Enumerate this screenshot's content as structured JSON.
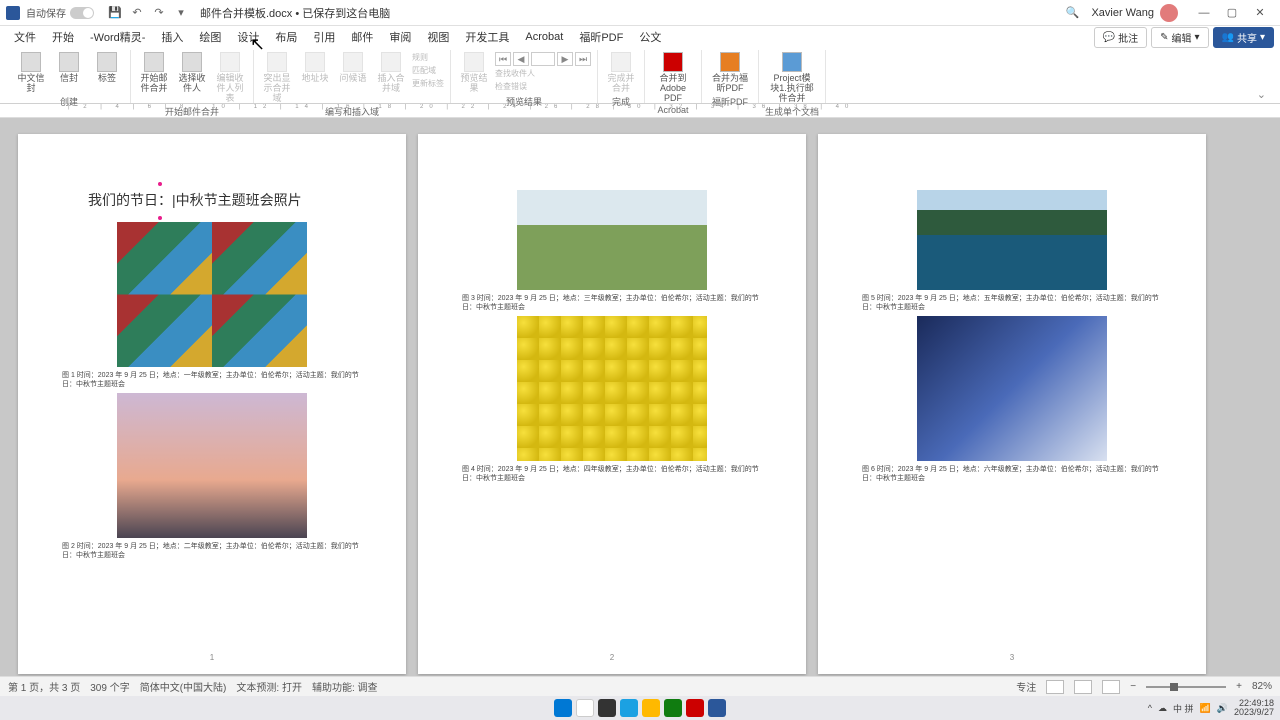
{
  "titlebar": {
    "autosave": "自动保存",
    "docname": "邮件合并模板.docx • 已保存到这台电脑",
    "user": "Xavier Wang"
  },
  "menu": {
    "tabs": [
      "文件",
      "开始",
      "-Word精灵-",
      "插入",
      "绘图",
      "设计",
      "布局",
      "引用",
      "邮件",
      "审阅",
      "视图",
      "开发工具",
      "Acrobat",
      "福昕PDF",
      "公文"
    ],
    "comment": "批注",
    "edit": "编辑",
    "share": "共享"
  },
  "ribbon": {
    "g1": {
      "label": "创建",
      "btns": [
        "中文信封",
        "信封",
        "标签"
      ]
    },
    "g2": {
      "label": "开始邮件合并",
      "btns": [
        "开始邮件合并",
        "选择收件人",
        "编辑收件人列表"
      ]
    },
    "g3": {
      "label": "编写和插入域",
      "btns": [
        "突出显示合并域",
        "地址块",
        "问候语",
        "插入合并域"
      ],
      "side": [
        "规则",
        "匹配域",
        "更新标签"
      ]
    },
    "g4": {
      "label": "预览结果",
      "btns": [
        "预览结果"
      ],
      "side": [
        "查找收件人",
        "检查错误"
      ]
    },
    "g5": {
      "label": "完成",
      "btns": [
        "完成并合并"
      ]
    },
    "g6": {
      "label": "Acrobat",
      "btns": [
        "合并到 Adobe PDF"
      ]
    },
    "g7": {
      "label": "福昕PDF",
      "btns": [
        "合并为福昕PDF"
      ]
    },
    "g8": {
      "label": "生成单个文档",
      "btns": [
        "Project模块1.执行邮件合并"
      ]
    }
  },
  "doc": {
    "title": "我们的节日：|中秋节主题班会照片",
    "captions": [
      "图 1  时间：2023 年 9 月 25 日；地点：一年级教室；主办单位：伯伦希尔；活动主题：我们的节日：中秋节主题班会",
      "图 2  时间：2023 年 9 月 25 日；地点：二年级教室；主办单位：伯伦希尔；活动主题：我们的节日：中秋节主题班会",
      "图 3  时间：2023 年 9 月 25 日；地点：三年级教室；主办单位：伯伦希尔；活动主题：我们的节日：中秋节主题班会",
      "图 4  时间：2023 年 9 月 25 日；地点：四年级教室；主办单位：伯伦希尔；活动主题：我们的节日：中秋节主题班会",
      "图 5  时间：2023 年 9 月 25 日；地点：五年级教室；主办单位：伯伦希尔；活动主题：我们的节日：中秋节主题班会",
      "图 6  时间：2023 年 9 月 25 日；地点：六年级教室；主办单位：伯伦希尔；活动主题：我们的节日：中秋节主题班会"
    ],
    "pages": [
      "1",
      "2",
      "3"
    ]
  },
  "status": {
    "page": "第 1 页，共 3 页",
    "words": "309 个字",
    "lang": "简体中文(中国大陆)",
    "pred": "文本预测: 打开",
    "acc": "辅助功能: 调查",
    "focus": "专注",
    "zoom": "82%"
  },
  "tray": {
    "ime": "中 拼",
    "time": "22:49:18",
    "date": "2023/9/27"
  }
}
